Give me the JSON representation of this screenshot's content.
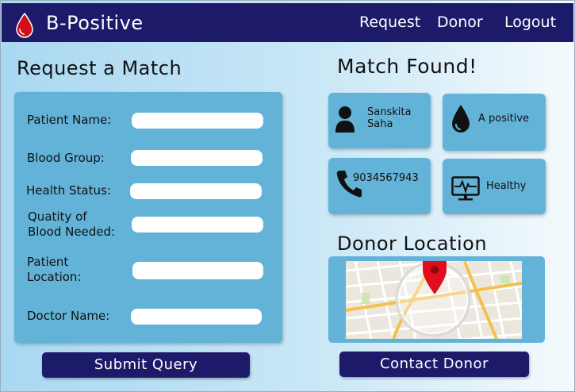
{
  "brand": {
    "name": "B-Positive",
    "accent": "#1d1a6a",
    "drop_color": "#d10f1a"
  },
  "nav": {
    "request": "Request",
    "donor": "Donor",
    "logout": "Logout"
  },
  "request_form": {
    "title": "Request a Match",
    "fields": {
      "patient_name": {
        "label": "Patient Name:",
        "value": ""
      },
      "blood_group": {
        "label": "Blood Group:",
        "value": ""
      },
      "health_status": {
        "label": "Health Status:",
        "value": ""
      },
      "quantity_line1": "Quatity of",
      "quantity_line2": "Blood Needed:",
      "quantity_value": "",
      "location_line1": "Patient",
      "location_line2": "Location:",
      "location_value": "",
      "doctor_name": {
        "label": "Doctor Name:",
        "value": ""
      }
    },
    "submit_label": "Submit Query"
  },
  "match": {
    "title": "Match Found!",
    "donor_name_line1": "Sanskita",
    "donor_name_line2": "Saha",
    "blood_group": "A positive",
    "phone": "9034567943",
    "health": "Healthy",
    "icons": [
      "person-icon",
      "blood-drop-icon",
      "phone-icon",
      "heart-monitor-icon"
    ]
  },
  "donor_location": {
    "title": "Donor Location",
    "marker_icon": "map-pin-icon"
  },
  "contact_label": "Contact Donor"
}
